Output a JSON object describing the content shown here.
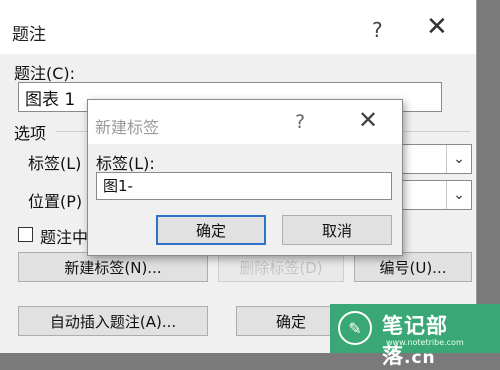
{
  "main": {
    "title": "题注",
    "help_glyph": "?",
    "close_glyph": "✕",
    "caption_label": "题注(C):",
    "caption_value": "图表 1",
    "options_group": "选项",
    "label_label": "标签(L)",
    "position_label": "位置(P)",
    "exclude_label": "题注中",
    "new_label_button": "新建标签(N)...",
    "delete_label_button": "删除标签(D)",
    "numbering_button": "编号(U)...",
    "autocaption_button": "自动插入题注(A)...",
    "ok_button": "确定"
  },
  "dialog": {
    "title": "新建标签",
    "help_glyph": "?",
    "close_glyph": "✕",
    "field_label": "标签(L):",
    "field_value": "图1-",
    "ok_button": "确定",
    "cancel_button": "取消"
  },
  "watermark": {
    "name": "笔记部落",
    "suffix": ".cn",
    "url": "www.notetribe.com",
    "icon": "pen-icon"
  },
  "colors": {
    "default_button_border": "#2f73c9",
    "watermark_bg": "#3aa876"
  }
}
